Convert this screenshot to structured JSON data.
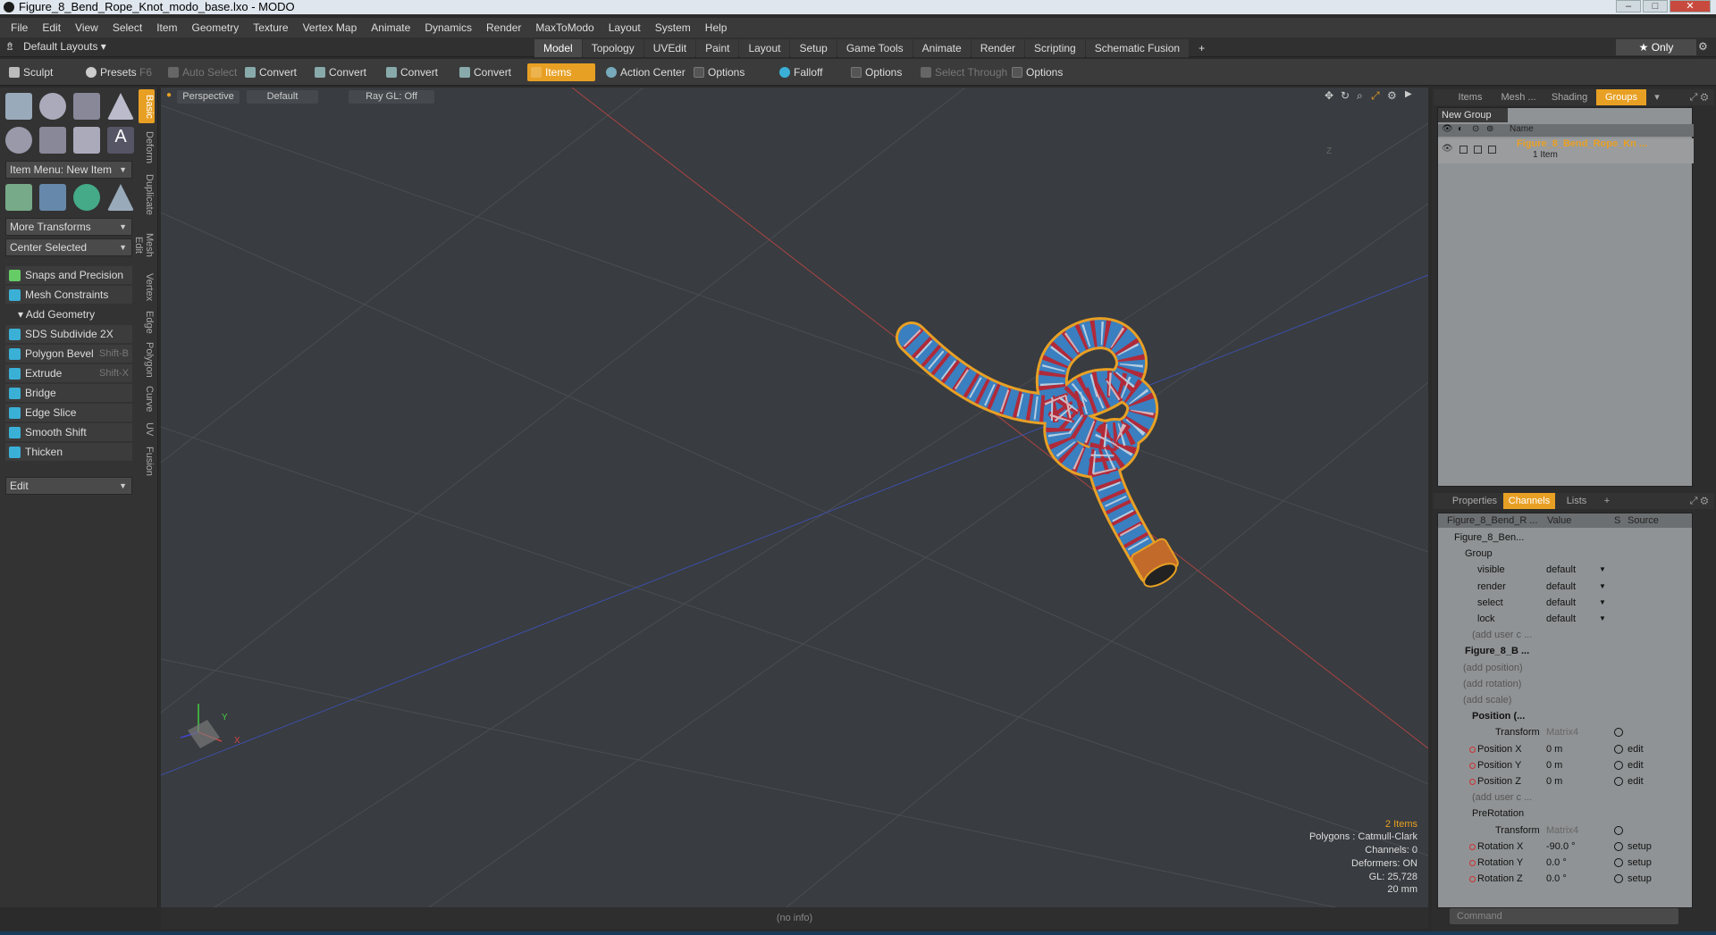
{
  "window": {
    "title": "Figure_8_Bend_Rope_Knot_modo_base.lxo - MODO"
  },
  "menu": [
    "File",
    "Edit",
    "View",
    "Select",
    "Item",
    "Geometry",
    "Texture",
    "Vertex Map",
    "Animate",
    "Dynamics",
    "Render",
    "MaxToModo",
    "Layout",
    "System",
    "Help"
  ],
  "modebar": {
    "layout": "Default Layouts",
    "tabs": [
      "Model",
      "Topology",
      "UVEdit",
      "Paint",
      "Layout",
      "Setup",
      "Game Tools",
      "Animate",
      "Render",
      "Scripting",
      "Schematic Fusion"
    ],
    "active": "Model",
    "plus": "+",
    "only": "Only"
  },
  "toolbar": {
    "sculpt": "Sculpt",
    "presets": "Presets",
    "presets_key": "F6",
    "auto_select": "Auto Select",
    "convert1": "Convert",
    "convert2": "Convert",
    "convert3": "Convert",
    "convert4": "Convert",
    "items": "Items",
    "action_center": "Action Center",
    "options1": "Options",
    "falloff": "Falloff",
    "options2": "Options",
    "select_through": "Select Through",
    "options3": "Options"
  },
  "left": {
    "item_menu": "Item Menu: New Item",
    "more_transforms": "More Transforms",
    "center_selected": "Center Selected",
    "snaps": "Snaps and Precision",
    "mesh_constraints": "Mesh Constraints",
    "add_geometry": "Add Geometry",
    "sds": "SDS Subdivide 2X",
    "polygon_bevel": "Polygon Bevel",
    "polygon_bevel_key": "Shift-B",
    "extrude": "Extrude",
    "extrude_key": "Shift-X",
    "bridge": "Bridge",
    "edge_slice": "Edge Slice",
    "smooth_shift": "Smooth Shift",
    "thicken": "Thicken",
    "edit": "Edit",
    "tabs": [
      "Basic",
      "Deform",
      "Duplicate",
      "Mesh Edit",
      "Vertex",
      "Edge",
      "Polygon",
      "Curve",
      "UV",
      "Fusion"
    ]
  },
  "viewport": {
    "view": "Perspective",
    "shading": "Default",
    "raygl": "Ray GL: Off",
    "axis_y": "Y",
    "axis_x": "X",
    "axis_z": "Z",
    "stats": {
      "items": "2 Items",
      "polygons": "Polygons : Catmull-Clark",
      "channels": "Channels: 0",
      "deformers": "Deformers: ON",
      "gl": "GL: 25,728",
      "scale": "20 mm"
    }
  },
  "status": "(no info)",
  "right": {
    "top_tabs": [
      "Items",
      "Mesh ...",
      "Shading",
      "Groups"
    ],
    "top_active": "Groups",
    "new_group": "New Group",
    "name_col": "Name",
    "group_name": "Figure_8_Bend_Rope_Kn ...",
    "group_count": "1 Item",
    "bottom_tabs": [
      "Properties",
      "Channels",
      "Lists",
      "+"
    ],
    "bottom_active": "Channels",
    "ch_head": {
      "name": "Figure_8_Bend_R ...",
      "value": "Value",
      "s": "S",
      "source": "Source"
    },
    "channels": [
      {
        "n": "Figure_8_Ben...",
        "ind": 18,
        "v": "",
        "src": ""
      },
      {
        "n": "Group",
        "ind": 30,
        "v": "",
        "src": ""
      },
      {
        "n": "visible",
        "ind": 44,
        "v": "default",
        "src": "",
        "dd": true
      },
      {
        "n": "render",
        "ind": 44,
        "v": "default",
        "src": "",
        "dd": true
      },
      {
        "n": "select",
        "ind": 44,
        "v": "default",
        "src": "",
        "dd": true
      },
      {
        "n": "lock",
        "ind": 44,
        "v": "default",
        "src": "",
        "dd": true
      },
      {
        "n": "(add user c ...",
        "ind": 38,
        "v": "",
        "src": "",
        "grey": true
      },
      {
        "n": "Figure_8_B ...",
        "ind": 30,
        "v": "",
        "src": "",
        "bold": true
      },
      {
        "n": "(add position)",
        "ind": 28,
        "v": "",
        "src": "",
        "grey": true
      },
      {
        "n": "(add rotation)",
        "ind": 28,
        "v": "",
        "src": "",
        "grey": true
      },
      {
        "n": "(add scale)",
        "ind": 28,
        "v": "",
        "src": "",
        "grey": true
      },
      {
        "n": "Position (...",
        "ind": 38,
        "v": "",
        "src": "",
        "bold": true
      },
      {
        "n": "Transform",
        "ind": 64,
        "v": "Matrix4",
        "src": "",
        "grey_v": true,
        "s": true
      },
      {
        "n": "Position X",
        "ind": 44,
        "v": "0 m",
        "src": "edit",
        "s": true,
        "dot": true
      },
      {
        "n": "Position Y",
        "ind": 44,
        "v": "0 m",
        "src": "edit",
        "s": true,
        "dot": true
      },
      {
        "n": "Position Z",
        "ind": 44,
        "v": "0 m",
        "src": "edit",
        "s": true,
        "dot": true
      },
      {
        "n": "(add user c ...",
        "ind": 38,
        "v": "",
        "src": "",
        "grey": true
      },
      {
        "n": "PreRotation",
        "ind": 38,
        "v": "",
        "src": ""
      },
      {
        "n": "Transform",
        "ind": 64,
        "v": "Matrix4",
        "src": "",
        "grey_v": true,
        "s": true
      },
      {
        "n": "Rotation X",
        "ind": 44,
        "v": "-90.0 °",
        "src": "setup",
        "s": true,
        "dot": true
      },
      {
        "n": "Rotation Y",
        "ind": 44,
        "v": "0.0 °",
        "src": "setup",
        "s": true,
        "dot": true
      },
      {
        "n": "Rotation Z",
        "ind": 44,
        "v": "0.0 °",
        "src": "setup",
        "s": true,
        "dot": true
      }
    ],
    "command": "Command"
  }
}
